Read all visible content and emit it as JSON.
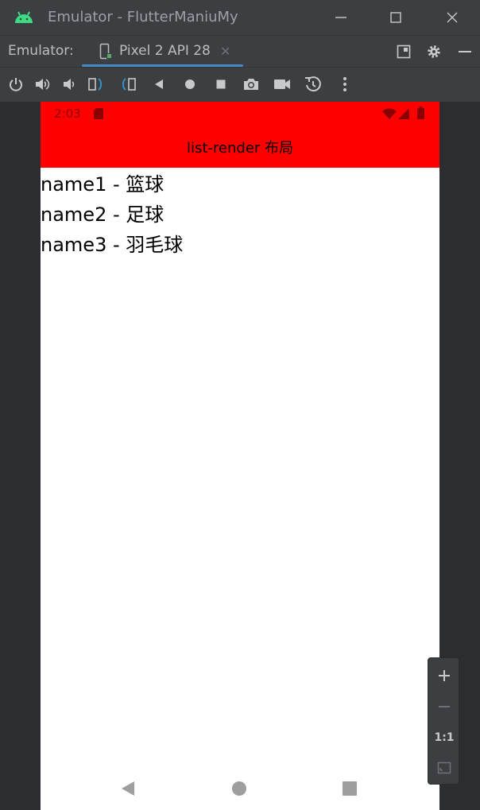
{
  "window": {
    "title": "Emulator - FlutterManiuMy",
    "icon": "android-icon",
    "controls": [
      "minimize-icon",
      "maximize-icon",
      "close-icon"
    ]
  },
  "tabbar": {
    "label": "Emulator:",
    "device_tab": {
      "label": "Pixel 2 API 28",
      "icon": "device-icon"
    },
    "right_icons": [
      "layout-icon",
      "gear-icon",
      "hide-icon"
    ]
  },
  "toolbar": {
    "icons": [
      "power-icon",
      "volume-up-icon",
      "volume-down-icon",
      "rotate-left-icon",
      "rotate-right-icon",
      "back-icon",
      "home-icon",
      "overview-icon",
      "camera-icon",
      "video-icon",
      "snapshot-icon",
      "more-icon"
    ]
  },
  "device": {
    "status": {
      "time": "2:03",
      "icons": [
        "sd-card-icon",
        "wifi-icon",
        "signal-icon",
        "battery-icon"
      ]
    },
    "appbar": {
      "title": "list-render 布局"
    },
    "items": [
      "name1 - 篮球",
      "name2 - 足球",
      "name3 - 羽毛球"
    ],
    "nav": [
      "nav-back-icon",
      "nav-home-icon",
      "nav-recents-icon"
    ]
  },
  "zoom": {
    "one_to_one": "1:1",
    "icons": [
      "zoom-in-icon",
      "zoom-out-icon",
      "fit-screen-icon"
    ]
  },
  "colors": {
    "appbar": "#ff0000",
    "frame": "#3c3f41",
    "accent": "#4a88c7"
  }
}
